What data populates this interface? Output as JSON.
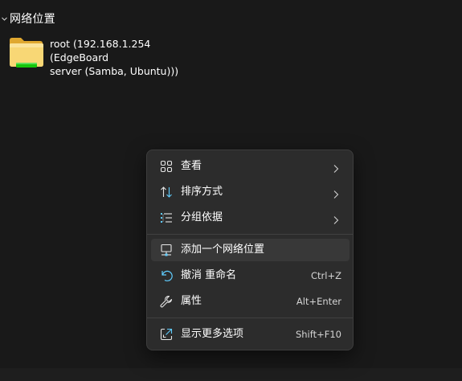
{
  "group": {
    "title": "网络位置",
    "chevron_icon": "chevron-down-icon"
  },
  "network_location": {
    "label_line1": "root (192.168.1.254 (EdgeBoard",
    "label_line2": "server (Samba, Ubuntu)))",
    "icon": "folder-network-icon"
  },
  "context_menu": {
    "items": [
      {
        "label": "查看",
        "icon": "grid-view-icon",
        "has_submenu": true
      },
      {
        "label": "排序方式",
        "icon": "sort-icon",
        "has_submenu": true
      },
      {
        "label": "分组依据",
        "icon": "group-by-icon",
        "has_submenu": true
      },
      {
        "label": "添加一个网络位置",
        "icon": "add-network-location-icon",
        "highlighted": true
      },
      {
        "label": "撤消 重命名",
        "icon": "undo-icon",
        "shortcut": "Ctrl+Z"
      },
      {
        "label": "属性",
        "icon": "wrench-icon",
        "shortcut": "Alt+Enter"
      },
      {
        "label": "显示更多选项",
        "icon": "show-more-options-icon",
        "shortcut": "Shift+F10"
      }
    ]
  },
  "colors": {
    "background": "#191919",
    "menu_background": "#2c2c2c",
    "menu_hover": "#383838",
    "accent_blue": "#60cdff",
    "folder_yellow": "#f8d775",
    "folder_green": "#16c60c"
  }
}
